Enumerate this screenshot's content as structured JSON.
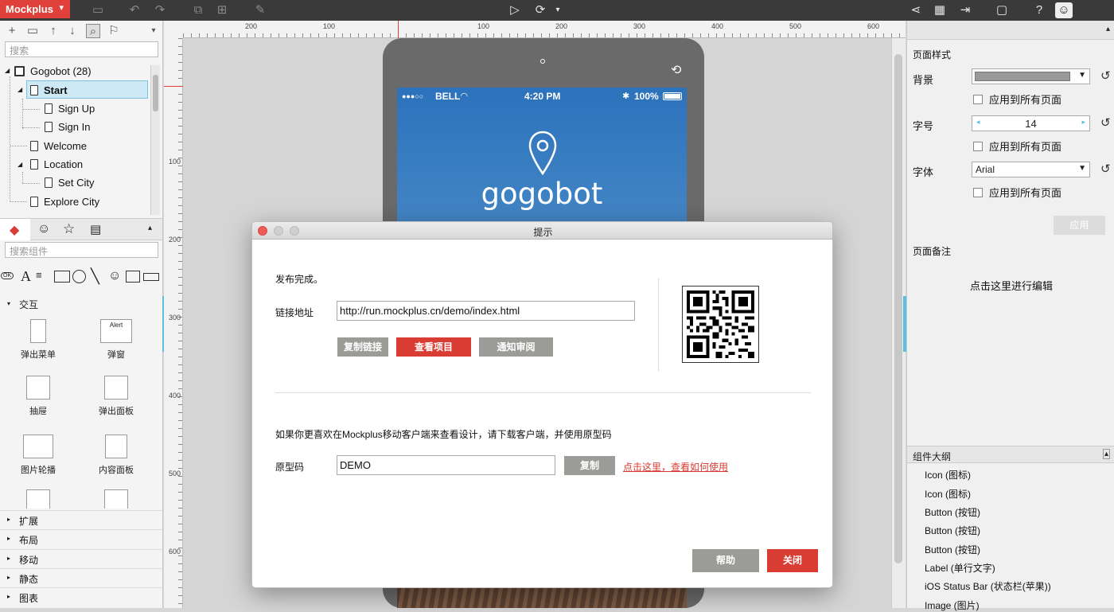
{
  "app": {
    "brand": "Mockplus"
  },
  "left_panel": {
    "search_placeholder": "搜索",
    "tree": {
      "root": "Gogobot (28)",
      "items": [
        {
          "label": "Start"
        },
        {
          "label": "Sign Up"
        },
        {
          "label": "Sign In"
        },
        {
          "label": "Welcome"
        },
        {
          "label": "Location"
        },
        {
          "label": "Set City"
        },
        {
          "label": "Explore City"
        }
      ]
    },
    "component_search_placeholder": "搜索组件",
    "component_section": "交互",
    "components": [
      {
        "label": "弹出菜单"
      },
      {
        "label": "弹窗",
        "preview_text": "Alert"
      },
      {
        "label": "抽屉"
      },
      {
        "label": "弹出面板"
      },
      {
        "label": "图片轮播"
      },
      {
        "label": "内容面板"
      }
    ],
    "categories": [
      "扩展",
      "布局",
      "移动",
      "静态",
      "图表"
    ],
    "ok_glyph": "OK"
  },
  "ruler": {
    "top": [
      "200",
      "100",
      "100",
      "200",
      "300",
      "400",
      "500",
      "600"
    ],
    "left": [
      "100",
      "200",
      "300",
      "400",
      "500",
      "600"
    ]
  },
  "device": {
    "carrier": "BELL",
    "time": "4:20 PM",
    "battery": "100%",
    "logo_text": "gogobot"
  },
  "dialog": {
    "title": "提示",
    "publish_done": "发布完成。",
    "link_label": "链接地址",
    "link_value": "http://run.mockplus.cn/demo/index.html",
    "copy_link": "复制链接",
    "view_project": "查看项目",
    "notify_review": "通知审阅",
    "mobile_hint": "如果你更喜欢在Mockplus移动客户端来查看设计，请下载客户端，并使用原型码",
    "code_label": "原型码",
    "code_value": "DEMO",
    "copy": "复制",
    "help_link": "点击这里，查看如何使用",
    "help_button": "帮助",
    "close_button": "关闭"
  },
  "right_panel": {
    "page_style": "页面样式",
    "background_label": "背景",
    "apply_all": "应用到所有页面",
    "font_size_label": "字号",
    "font_size_value": "14",
    "font_label": "字体",
    "font_value": "Arial",
    "apply_button": "应用",
    "notes_label": "页面备注",
    "notes_placeholder": "点击这里进行编辑",
    "outline_title": "组件大纲",
    "outline_items": [
      "Icon (图标)",
      "Icon (图标)",
      "Button (按钮)",
      "Button (按钮)",
      "Button (按钮)",
      "Label (单行文字)",
      "iOS Status Bar (状态栏(苹果))",
      "Image (图片)"
    ]
  },
  "colors": {
    "accent": "#d83c33",
    "selection": "#cde9f5",
    "toolbar": "#3a3a3a"
  }
}
